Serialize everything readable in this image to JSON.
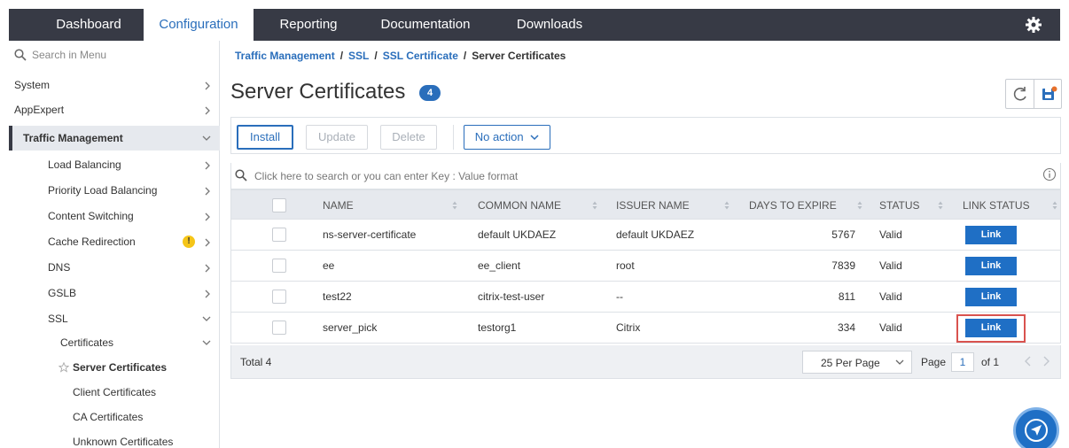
{
  "nav": {
    "tabs": [
      {
        "label": "Dashboard"
      },
      {
        "label": "Configuration"
      },
      {
        "label": "Reporting"
      },
      {
        "label": "Documentation"
      },
      {
        "label": "Downloads"
      }
    ],
    "active_tab": "Configuration"
  },
  "sidebar": {
    "search_placeholder": "Search in Menu",
    "items": [
      {
        "label": "System"
      },
      {
        "label": "AppExpert"
      },
      {
        "label": "Traffic Management"
      },
      {
        "label": "Load Balancing"
      },
      {
        "label": "Priority Load Balancing"
      },
      {
        "label": "Content Switching"
      },
      {
        "label": "Cache Redirection",
        "badge": "!"
      },
      {
        "label": "DNS"
      },
      {
        "label": "GSLB"
      },
      {
        "label": "SSL"
      },
      {
        "label": "Certificates"
      },
      {
        "label": "Server Certificates"
      },
      {
        "label": "Client Certificates"
      },
      {
        "label": "CA Certificates"
      },
      {
        "label": "Unknown Certificates"
      }
    ]
  },
  "breadcrumb": {
    "items": [
      "Traffic Management",
      "SSL",
      "SSL Certificate"
    ],
    "separator": "/",
    "current": "Server Certificates"
  },
  "page": {
    "title": "Server Certificates",
    "count": "4"
  },
  "toolbar": {
    "install": "Install",
    "update": "Update",
    "delete": "Delete",
    "action_select": "No action"
  },
  "search": {
    "placeholder": "Click here to search or you can enter Key : Value format"
  },
  "table": {
    "columns": [
      "NAME",
      "COMMON NAME",
      "ISSUER NAME",
      "DAYS TO EXPIRE",
      "STATUS",
      "LINK STATUS"
    ],
    "rows": [
      {
        "name": "ns-server-certificate",
        "common_name": "default UKDAEZ",
        "issuer": "default UKDAEZ",
        "days": "5767",
        "status": "Valid",
        "link": "Link"
      },
      {
        "name": "ee",
        "common_name": "ee_client",
        "issuer": "root",
        "days": "7839",
        "status": "Valid",
        "link": "Link"
      },
      {
        "name": "test22",
        "common_name": "citrix-test-user",
        "issuer": "--",
        "days": "811",
        "status": "Valid",
        "link": "Link"
      },
      {
        "name": "server_pick",
        "common_name": "testorg1",
        "issuer": "Citrix",
        "days": "334",
        "status": "Valid",
        "link": "Link"
      }
    ],
    "highlighted_row": 3
  },
  "footer": {
    "total": "Total 4",
    "per_page": "25 Per Page",
    "page_label": "Page",
    "page": "1",
    "of": "of 1"
  },
  "colors": {
    "topbar": "#373a45",
    "accent": "#2a6ebb",
    "link_button": "#1f6fc5",
    "highlight": "#d9534f",
    "warning": "#f5c518"
  },
  "icons": [
    "gear-icon",
    "search-icon",
    "chevron-right-icon",
    "chevron-down-icon",
    "warning-icon",
    "star-icon",
    "refresh-icon",
    "save-config-icon",
    "info-icon",
    "sort-icon",
    "navigate-icon"
  ]
}
